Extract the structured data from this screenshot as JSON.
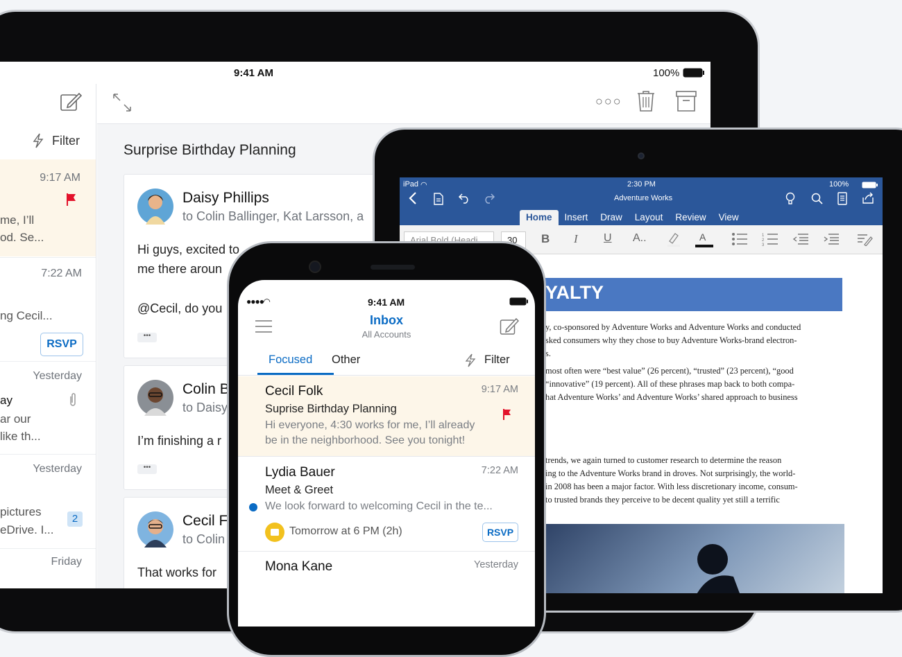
{
  "tablet_outlook": {
    "status": {
      "time": "9:41 AM",
      "battery": "100%"
    },
    "list": {
      "filter_label": "Filter",
      "items": [
        {
          "time": "9:17 AM",
          "preview1": "me, I’ll",
          "preview2": "od. Se..."
        },
        {
          "time": "7:22 AM",
          "preview1": "ng Cecil...",
          "rsvp": "RSVP"
        },
        {
          "time": "Yesterday",
          "sender": "ay",
          "preview1": "ar our",
          "preview2": " like th..."
        },
        {
          "time": "Yesterday",
          "preview1": " pictures",
          "preview2": "eDrive. I...",
          "count": "2"
        },
        {
          "time": "Friday"
        }
      ]
    },
    "reading": {
      "subject": "Surprise Birthday Planning",
      "messages": [
        {
          "sender": "Daisy Phillips",
          "to": "to Colin Ballinger, Kat Larsson, a",
          "line1": "Hi guys, excited to",
          "line2": "me there aroun",
          "line3": "@Cecil, do you"
        },
        {
          "sender": "Colin B",
          "to": "to Daisy",
          "line1": "I’m finishing a r"
        },
        {
          "sender": "Cecil F",
          "to": "to Colin",
          "line1": "That works for"
        }
      ]
    }
  },
  "tablet_word": {
    "status": {
      "device": "iPad",
      "time": "2:30 PM",
      "battery": "100%"
    },
    "doc_title": "Adventure Works",
    "tabs": [
      "Home",
      "Insert",
      "Draw",
      "Layout",
      "Review",
      "View"
    ],
    "active_tab": "Home",
    "font_name": "Arial Bold (Headi",
    "font_size": "30",
    "heading": "YALTY",
    "paragraphs": [
      [
        "y, co-sponsored by Adventure Works and Adventure Works and conducted",
        "sked consumers why they chose to buy Adventure Works-brand electron-",
        "s."
      ],
      [
        "most often were “best value” (26 percent), “trusted” (23 percent), “good",
        "“innovative” (19 percent). All of these phrases map back to both compa-",
        "hat Adventure Works’ and Adventure Works’ shared approach to business"
      ],
      [
        "trends, we again turned to customer research to determine the reason",
        "ing to the Adventure Works brand in droves. Not surprisingly, the world-",
        "in 2008 has been a major factor. With less discretionary income, consum-",
        "to trusted brands they perceive to be decent quality yet still a terrific"
      ]
    ]
  },
  "phone": {
    "status": {
      "time": "9:41 AM"
    },
    "title": "Inbox",
    "subtitle": "All Accounts",
    "tabs": {
      "focused": "Focused",
      "other": "Other",
      "filter": "Filter"
    },
    "mails": [
      {
        "sender": "Cecil Folk",
        "time": "9:17 AM",
        "subject": "Suprise Birthday Planning",
        "preview1": "Hi everyone, 4:30 works for me, I’ll already",
        "preview2": "be in the neighborhood. See you tonight!"
      },
      {
        "sender": "Lydia Bauer",
        "time": "7:22 AM",
        "subject": "Meet & Greet",
        "preview1": "We look forward to welcoming Cecil in the te...",
        "event": "Tomorrow at 6 PM (2h)",
        "rsvp": "RSVP"
      },
      {
        "sender": "Mona Kane",
        "time": "Yesterday"
      }
    ]
  },
  "colors": {
    "accent": "#0a6bc4",
    "word_blue": "#2b579a",
    "flag": "#e3122b",
    "highlight_row": "#fdf6e9"
  }
}
